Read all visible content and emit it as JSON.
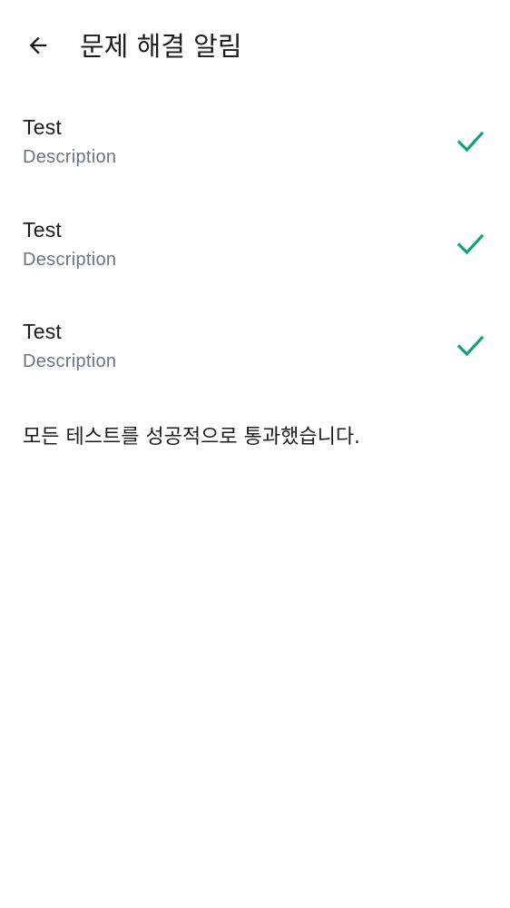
{
  "header": {
    "title": "문제 해결 알림",
    "back_icon": "arrow-back-icon"
  },
  "tests": [
    {
      "title": "Test",
      "description": "Description",
      "status_icon": "check-icon"
    },
    {
      "title": "Test",
      "description": "Description",
      "status_icon": "check-icon"
    },
    {
      "title": "Test",
      "description": "Description",
      "status_icon": "check-icon"
    }
  ],
  "summary": "모든 테스트를 성공적으로 통과했습니다.",
  "colors": {
    "check": "#10a37f",
    "text_primary": "#1c1b1f",
    "text_secondary": "#6b7280",
    "background": "#ffffff"
  }
}
